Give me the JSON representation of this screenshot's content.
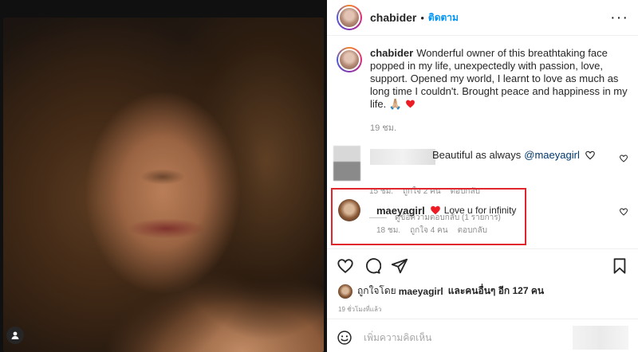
{
  "post": {
    "username": "chabider",
    "dot": "•",
    "follow_label": "ติดตาม",
    "more_label": "···"
  },
  "caption": {
    "username": "chabider",
    "text": "Wonderful owner of this breathtaking face popped in my life, unexpectedly with passion, love, support. Opened my world, I learnt to love as much as long time I couldn't. Brought peace and happiness in my life. 🙏🏼",
    "time": "19 ชม."
  },
  "comments": [
    {
      "text": "Beautiful as always",
      "mention": "@maeyagirl",
      "time": "15 ชม.",
      "likes": "ถูกใจ 2 คน",
      "reply_label": "ตอบกลับ",
      "view_replies": "ดูข้อความตอบกลับ (1 รายการ)"
    }
  ],
  "reply": {
    "username": "maeyagirl",
    "text": "Love u for infinity",
    "time": "18 ชม.",
    "likes": "ถูกใจ 4 คน",
    "reply_label": "ตอบกลับ"
  },
  "likes": {
    "prefix": "ถูกใจโดย",
    "user": "maeyagirl",
    "suffix": "และคนอื่นๆ อีก 127 คน"
  },
  "post_age": "19 ชั่วโมงที่แล้ว",
  "compose": {
    "placeholder": "เพิ่มความคิดเห็น"
  },
  "colors": {
    "accent": "#0095f6",
    "highlight": "#e0262c",
    "heart": "#ed4956"
  },
  "icons": [
    "heart-icon",
    "comment-icon",
    "share-icon",
    "bookmark-icon",
    "emoji-icon",
    "user-tag-icon",
    "more-icon"
  ]
}
